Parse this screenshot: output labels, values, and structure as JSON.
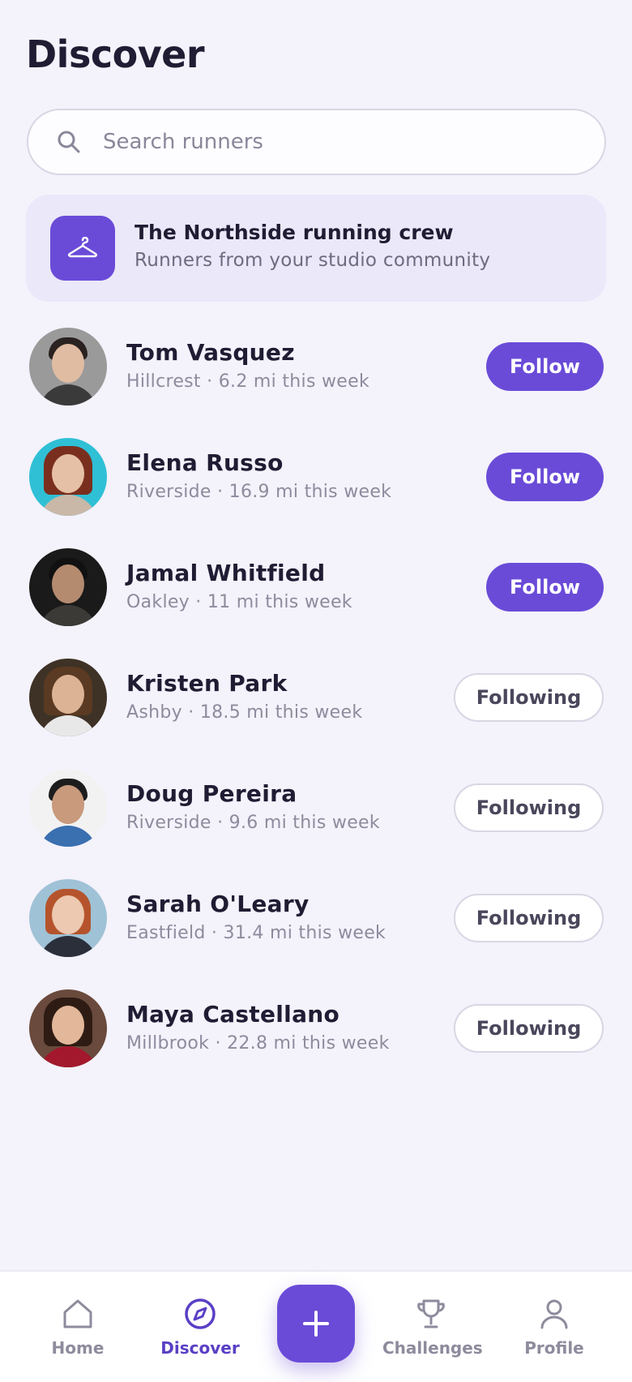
{
  "header": {
    "title": "Discover"
  },
  "search": {
    "placeholder": "Search runners"
  },
  "crew": {
    "title": "The Northside running crew",
    "subtitle": "Runners from your studio community",
    "icon": "hanger-icon"
  },
  "runners": [
    {
      "name": "Tom Vasquez",
      "meta": "Hillcrest · 6.2 mi this week",
      "action": "Follow"
    },
    {
      "name": "Elena Russo",
      "meta": "Riverside · 16.9 mi this week",
      "action": "Follow"
    },
    {
      "name": "Jamal Whitfield",
      "meta": "Oakley · 11 mi this week",
      "action": "Follow"
    },
    {
      "name": "Kristen Park",
      "meta": "Ashby · 18.5 mi this week",
      "action": "Following"
    },
    {
      "name": "Doug Pereira",
      "meta": "Riverside · 9.6 mi this week",
      "action": "Following"
    },
    {
      "name": "Sarah O'Leary",
      "meta": "Eastfield · 31.4 mi this week",
      "action": "Following"
    },
    {
      "name": "Maya Castellano",
      "meta": "Millbrook · 22.8 mi this week",
      "action": "Following"
    }
  ],
  "tabbar": {
    "home": "Home",
    "discover": "Discover",
    "challenges": "Challenges",
    "profile": "Profile",
    "active": "discover"
  },
  "colors": {
    "accent": "#6a4bd8",
    "background": "#f4f2fb",
    "crew_card": "#ebe8f9"
  }
}
